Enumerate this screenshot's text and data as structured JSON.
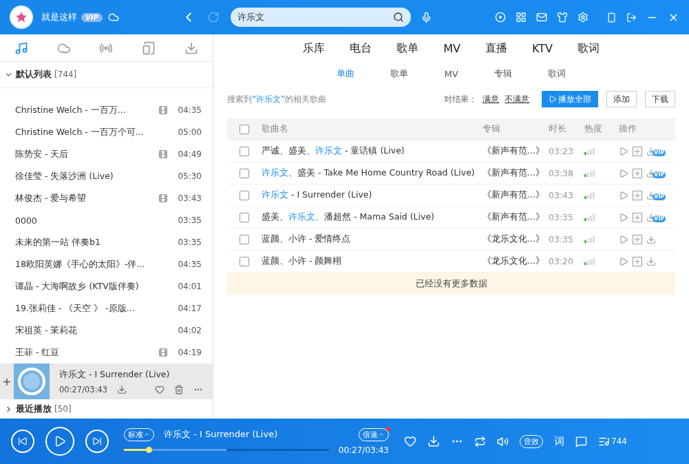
{
  "topbar": {
    "user": "就是这样",
    "vip": "VIP",
    "search": {
      "value": "许乐文"
    }
  },
  "side_tabs": [
    {
      "selected": true
    },
    {
      "selected": false
    },
    {
      "selected": false
    },
    {
      "selected": false
    },
    {
      "selected": false
    }
  ],
  "playlist": {
    "title": "默认列表",
    "count": "[744]",
    "expanded": true,
    "songs": [
      {
        "title": "Christine Welch - 一百万...",
        "mv": true,
        "duration": "04:35"
      },
      {
        "title": "Christine Welch - 一百万个可...",
        "mv": false,
        "duration": "05:00"
      },
      {
        "title": "陈势安 - 天后",
        "mv": true,
        "duration": "04:49"
      },
      {
        "title": "徐佳莹 - 失落沙洲 (Live)",
        "mv": false,
        "duration": "05:30"
      },
      {
        "title": "林俊杰 - 爱与希望",
        "mv": true,
        "duration": "03:43"
      },
      {
        "title": "0000",
        "mv": false,
        "duration": "03:35"
      },
      {
        "title": "未来的第一站 伴奏b1",
        "mv": false,
        "duration": "03:35"
      },
      {
        "title": "18欧阳英娜《手心的太阳》-伴...",
        "mv": false,
        "duration": "04:35"
      },
      {
        "title": "谭晶 - 大海啊故乡 (KTV版伴奏)",
        "mv": false,
        "duration": "04:01"
      },
      {
        "title": "19.张莉佳 - 《天空 》 -原版...",
        "mv": false,
        "duration": "04:17"
      },
      {
        "title": "宋祖英 - 茉莉花",
        "mv": false,
        "duration": "04:02"
      },
      {
        "title": "王菲 - 红豆",
        "mv": true,
        "duration": "04:19"
      }
    ]
  },
  "now_playing": {
    "add": "+",
    "title": "许乐文 - I Surrender (Live)",
    "time": "00:27/03:43"
  },
  "recent": {
    "title": "最近播放",
    "count": "[50]",
    "expanded": false
  },
  "nav": [
    {
      "label": "乐库",
      "selected": false
    },
    {
      "label": "电台",
      "selected": false
    },
    {
      "label": "歌单",
      "selected": false
    },
    {
      "label": "MV",
      "selected": false
    },
    {
      "label": "直播",
      "selected": false
    },
    {
      "label": "KTV",
      "selected": false
    },
    {
      "label": "歌词",
      "selected": false
    }
  ],
  "sub_tabs": [
    {
      "label": "单曲",
      "selected": true
    },
    {
      "label": "歌单",
      "selected": false
    },
    {
      "label": "MV",
      "selected": false
    },
    {
      "label": "专辑",
      "selected": false
    },
    {
      "label": "歌词",
      "selected": false
    }
  ],
  "result": {
    "parts": [
      {
        "text": "搜索到",
        "hl": false
      },
      {
        "text": "“许乐文”",
        "hl": true
      },
      {
        "text": "的相关歌曲",
        "hl": false
      }
    ],
    "feedback_label": "对结果：",
    "satisfied": "满意",
    "unsatisfied": "不满意",
    "play_all": "播放全部",
    "add": "添加",
    "download": "下载"
  },
  "table": {
    "all_checked": false,
    "columns": [
      "歌曲名",
      "专辑",
      "时长",
      "热度",
      "操作"
    ],
    "rows": [
      {
        "checked": false,
        "parts": [
          {
            "text": "严诚、盛美、",
            "hl": false
          },
          {
            "text": "许乐文",
            "hl": true
          },
          {
            "text": " - 童话镇 (Live)",
            "hl": false
          }
        ],
        "album": "《新声有范...》",
        "duration": "03:23",
        "level": 0.25,
        "badge": "VIP"
      },
      {
        "checked": false,
        "parts": [
          {
            "text": "许乐文",
            "hl": true
          },
          {
            "text": "、盛美 - Take Me Home Country Road (Live)",
            "hl": false
          }
        ],
        "album": "《新声有范...》",
        "duration": "03:38",
        "level": 0.25,
        "badge": "VIP"
      },
      {
        "checked": false,
        "parts": [
          {
            "text": "许乐文",
            "hl": true
          },
          {
            "text": " - I Surrender (Live)",
            "hl": false
          }
        ],
        "album": "《新声有范...》",
        "duration": "03:43",
        "level": 0.25,
        "badge": "VIP"
      },
      {
        "checked": false,
        "parts": [
          {
            "text": "盛美、",
            "hl": false
          },
          {
            "text": "许乐文",
            "hl": true
          },
          {
            "text": "、潘超然 - Mama Said (Live)",
            "hl": false
          }
        ],
        "album": "《新声有范...》",
        "duration": "03:35",
        "level": 0.25,
        "badge": "VIP"
      },
      {
        "checked": false,
        "parts": [
          {
            "text": "蓝颜、小许 - 爱情终点",
            "hl": false
          }
        ],
        "album": "《龙乐文化...》",
        "duration": "03:35",
        "level": 0.25
      },
      {
        "checked": false,
        "parts": [
          {
            "text": "蓝颜、小许 - 颜舞栩",
            "hl": false
          }
        ],
        "album": "《龙乐文化...》",
        "duration": "03:20",
        "level": 0.25
      }
    ],
    "footer": "已经没有更多数据"
  },
  "player": {
    "quality": "标准",
    "title": "许乐文 - I Surrender (Live)",
    "level": 0.12,
    "speed": "倍速",
    "time": "00:27/03:43",
    "effect": "音效",
    "lyrics": "词",
    "queue_count": "744"
  }
}
